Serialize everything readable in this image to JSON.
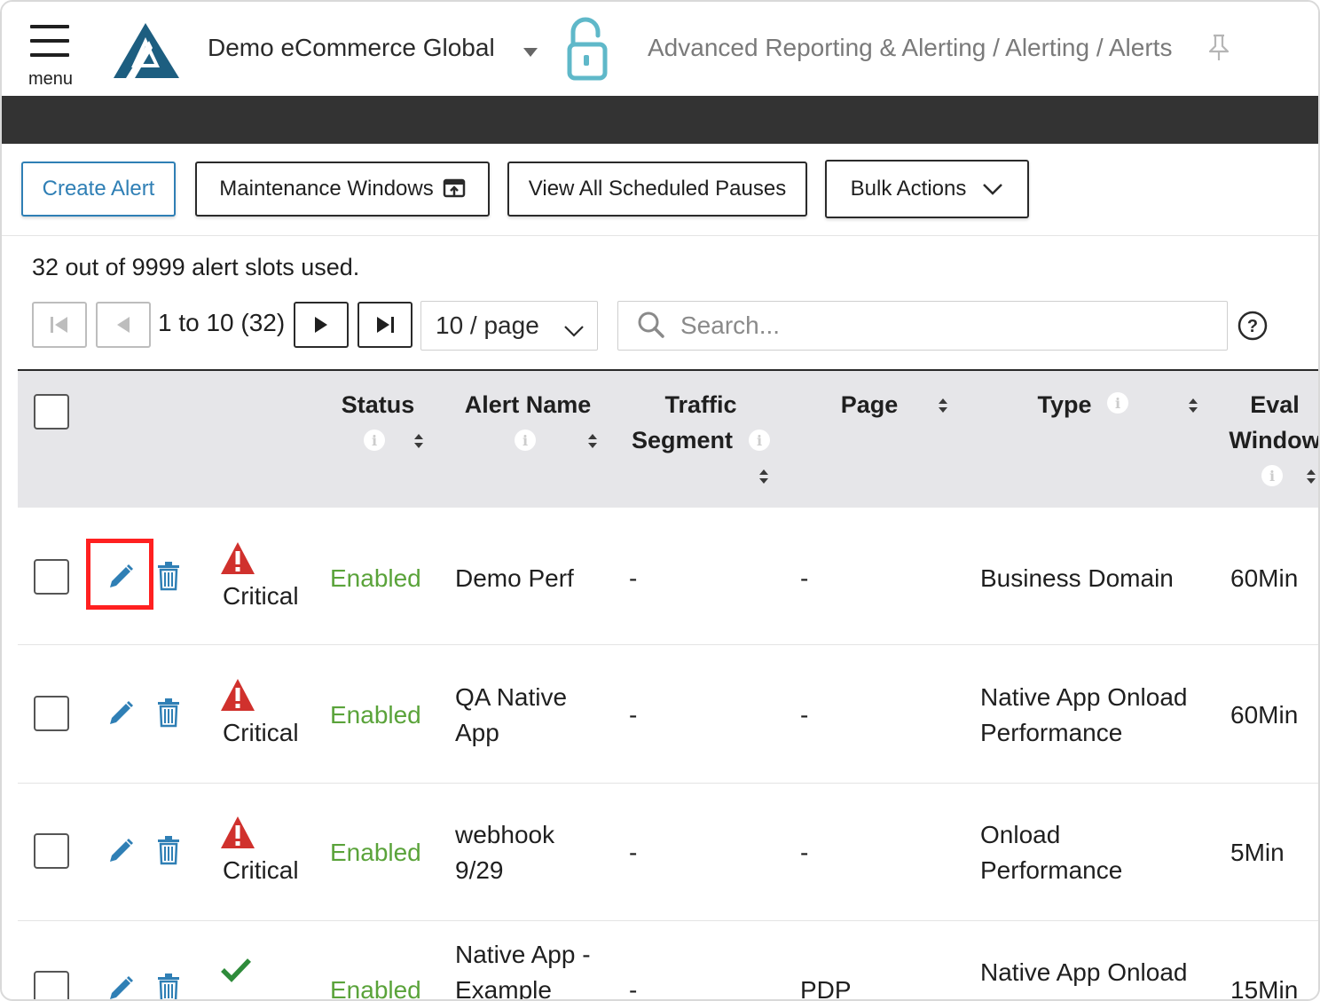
{
  "header": {
    "menu_label": "menu",
    "org_name": "Demo eCommerce Global",
    "breadcrumb": "Advanced Reporting & Alerting / Alerting / Alerts"
  },
  "toolbar": {
    "create_alert": "Create Alert",
    "maintenance_windows": "Maintenance Windows",
    "view_scheduled_pauses": "View All Scheduled Pauses",
    "bulk_actions": "Bulk Actions"
  },
  "slots_text": "32 out of 9999 alert slots used.",
  "pager": {
    "range": "1 to 10 (32)",
    "page_size": "10 / page"
  },
  "search": {
    "placeholder": "Search..."
  },
  "columns": {
    "status": "Status",
    "alert_name": "Alert Name",
    "traffic": "Traffic",
    "segment": "Segment",
    "page": "Page",
    "type": "Type",
    "eval": "Eval",
    "window": "Window"
  },
  "rows": [
    {
      "severity": "Critical",
      "status": "Enabled",
      "name1": "Demo Perf",
      "name2": "",
      "traffic": "-",
      "page": "-",
      "type1": "Business Domain",
      "type2": "",
      "eval": "60Min"
    },
    {
      "severity": "Critical",
      "status": "Enabled",
      "name1": "QA Native",
      "name2": "App",
      "traffic": "-",
      "page": "-",
      "type1": "Native App Onload",
      "type2": "Performance",
      "eval": "60Min"
    },
    {
      "severity": "Critical",
      "status": "Enabled",
      "name1": "webhook",
      "name2": "9/29",
      "traffic": "-",
      "page": "-",
      "type1": "Onload",
      "type2": "Performance",
      "eval": "5Min"
    },
    {
      "severity": "",
      "status": "Enabled",
      "name1": "Native App -",
      "name2": "Example",
      "traffic": "-",
      "page": "PDP",
      "type1": "Native App Onload",
      "type2": "",
      "eval": "15Min"
    }
  ],
  "colors": {
    "accent": "#2f7fb5",
    "enabled": "#5aa33a",
    "critical": "#d0312d",
    "header_band": "#333333",
    "highlight": "#ff2020"
  }
}
